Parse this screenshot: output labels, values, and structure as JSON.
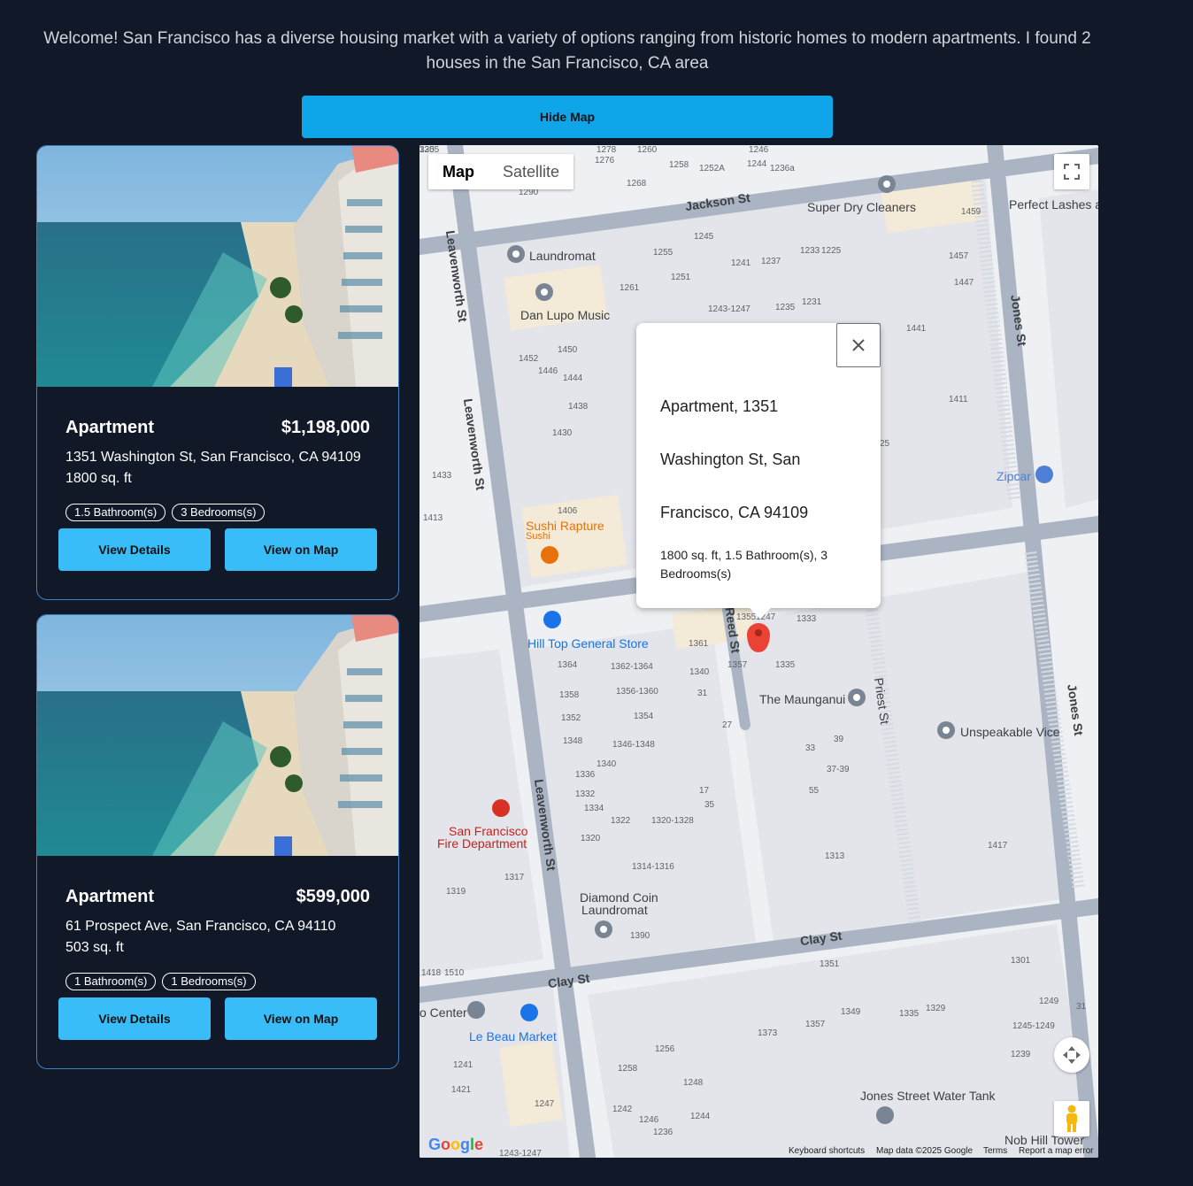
{
  "intro": {
    "text": "Welcome! San Francisco has a diverse housing market with a variety of options ranging from historic homes to modern apartments. I found 2 houses in the San Francisco, CA area"
  },
  "toggle_map_label": "Hide Map",
  "listings": [
    {
      "type": "Apartment",
      "price": "$1,198,000",
      "address": "1351 Washington St, San Francisco, CA 94109",
      "sqft": "1800 sq. ft",
      "bathrooms": "1.5 Bathroom(s)",
      "bedrooms": "3 Bedrooms(s)",
      "details_label": "View Details",
      "map_label": "View on Map"
    },
    {
      "type": "Apartment",
      "price": "$599,000",
      "address": "61 Prospect Ave, San Francisco, CA 94110",
      "sqft": "503 sq. ft",
      "bathrooms": "1 Bathroom(s)",
      "bedrooms": "1 Bedrooms(s)",
      "details_label": "View Details",
      "map_label": "View on Map"
    }
  ],
  "map": {
    "type_map": "Map",
    "type_satellite": "Satellite",
    "popup": {
      "line1": "Apartment, 1351",
      "line2": "Washington St, San",
      "line3": "Francisco, CA 94109",
      "details": "1800 sq. ft, 1.5 Bathroom(s), 3 Bedrooms(s)"
    },
    "streets": {
      "jackson": "Jackson St",
      "leavenworth": "Leavenworth St",
      "jones": "Jones St",
      "clay": "Clay St",
      "reed": "Reed St",
      "priest": "Priest St"
    },
    "pois": {
      "super_dry": "Super Dry Cleaners",
      "perfect_lashes": "Perfect Lashes a",
      "laundromat": "Laundromat",
      "dan_lupo": "Dan Lupo Music",
      "zipcar": "Zipcar",
      "sushi_rapture": "Sushi Rapture",
      "sushi_sub": "Sushi",
      "hill_top": "Hill Top General Store",
      "maunganui": "The Maunganui",
      "unspeakable": "Unspeakable Vice",
      "fire_dept_1": "San Francisco",
      "fire_dept_2": "Fire Department",
      "diamond_1": "Diamond Coin",
      "diamond_2": "Laundromat",
      "center": "o Center",
      "le_beau": "Le Beau Market",
      "water_tank": "Jones Street Water Tank",
      "nob_hill": "Nob Hill Tower"
    },
    "numbers": [
      "1278",
      "1260",
      "1246",
      "1276",
      "1258",
      "1252A",
      "1244",
      "1236a",
      "1268",
      "1290",
      "1245",
      "1255",
      "1241",
      "1237",
      "1233",
      "1225",
      "1251",
      "1261",
      "1243-1247",
      "1235",
      "1231",
      "1459",
      "1457",
      "1447",
      "1441",
      "1411",
      "1450",
      "1452",
      "1446",
      "1444",
      "1438",
      "1430",
      "1433",
      "1413",
      "1406",
      "1355",
      "1333",
      "1361",
      "1357",
      "1335",
      "1364",
      "1362-1364",
      "1356-1360",
      "1358",
      "1354",
      "1352",
      "1348",
      "1346-1348",
      "1340",
      "1336",
      "1332",
      "1334",
      "1322",
      "1320-1328",
      "1320",
      "1314-1316",
      "1390",
      "1317",
      "1319",
      "1418",
      "1510",
      "1351",
      "1301",
      "1349",
      "1335",
      "1329",
      "1249",
      "1245-1249",
      "1239",
      "1373",
      "1357",
      "1256",
      "1258",
      "1248",
      "1244",
      "1242",
      "1246",
      "1236",
      "1247",
      "1243-1247",
      "1241",
      "1421",
      "1417",
      "1313",
      "1340",
      "31",
      "27",
      "17",
      "35",
      "39",
      "33",
      "55",
      "37-39",
      "31",
      "25",
      "1247",
      "320",
      "1355"
    ],
    "footer": {
      "shortcuts": "Keyboard shortcuts",
      "data": "Map data ©2025 Google",
      "terms": "Terms",
      "report": "Report a map error"
    },
    "logo": "Google"
  },
  "colors": {
    "background": "#111827",
    "accent_button": "#0ea5e9",
    "card_button": "#38bdf8",
    "card_border": "#3b82c4",
    "marker": "#ea4335"
  }
}
